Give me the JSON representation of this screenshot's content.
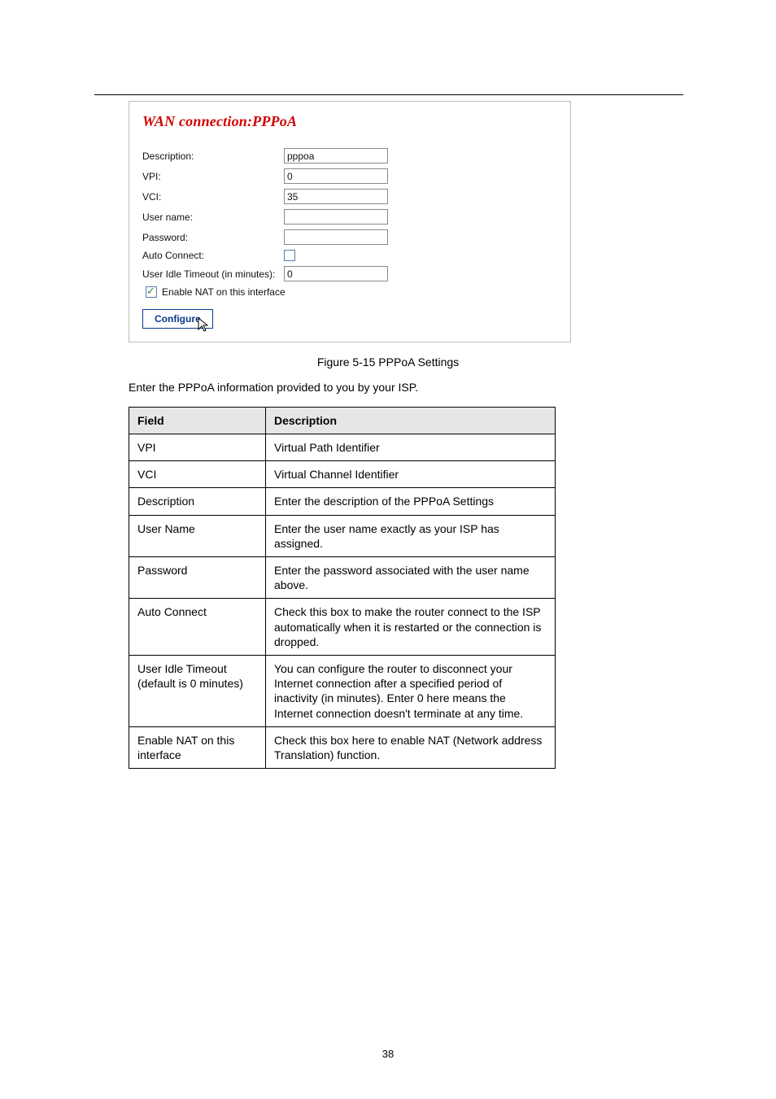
{
  "doc": {
    "figure_caption": "Figure 5-15 PPPoA Settings",
    "instruction": "Enter the PPPoA information provided to you by your ISP.",
    "page_number": "38"
  },
  "panel": {
    "title": "WAN connection:PPPoA",
    "fields": {
      "description": {
        "label": "Description:",
        "value": "pppoa"
      },
      "vpi": {
        "label": "VPI:",
        "value": "0"
      },
      "vci": {
        "label": "VCI:",
        "value": "35"
      },
      "username": {
        "label": "User name:",
        "value": ""
      },
      "password": {
        "label": "Password:",
        "value": ""
      },
      "auto_connect": {
        "label": "Auto Connect:"
      },
      "idle_timeout": {
        "label": "User Idle Timeout (in minutes):",
        "value": "0"
      },
      "enable_nat": {
        "label": "Enable NAT on this interface"
      }
    },
    "buttons": {
      "configure": "Configure"
    }
  },
  "table": {
    "headers": {
      "field": "Field",
      "description": "Description"
    },
    "rows": [
      {
        "field": "VPI",
        "desc": "Virtual Path Identifier"
      },
      {
        "field": "VCI",
        "desc": "Virtual Channel Identifier"
      },
      {
        "field": "Description",
        "desc": "Enter the description of the PPPoA Settings"
      },
      {
        "field": "User Name",
        "desc": "Enter the user name exactly as your ISP has assigned."
      },
      {
        "field": "Password",
        "desc": "Enter the password associated with the user name above."
      },
      {
        "field": "Auto Connect",
        "desc": "Check this box to make the router connect to the ISP automatically when it is restarted or the connection is dropped."
      },
      {
        "field": "User Idle Timeout (default is 0 minutes)",
        "desc": "You can configure the router to disconnect your Internet connection after a specified period of inactivity (in minutes).  Enter 0 here means the Internet connection doesn't terminate at any time."
      },
      {
        "field": "Enable NAT on this interface",
        "desc": "Check this box here to enable NAT (Network address Translation) function."
      }
    ]
  }
}
